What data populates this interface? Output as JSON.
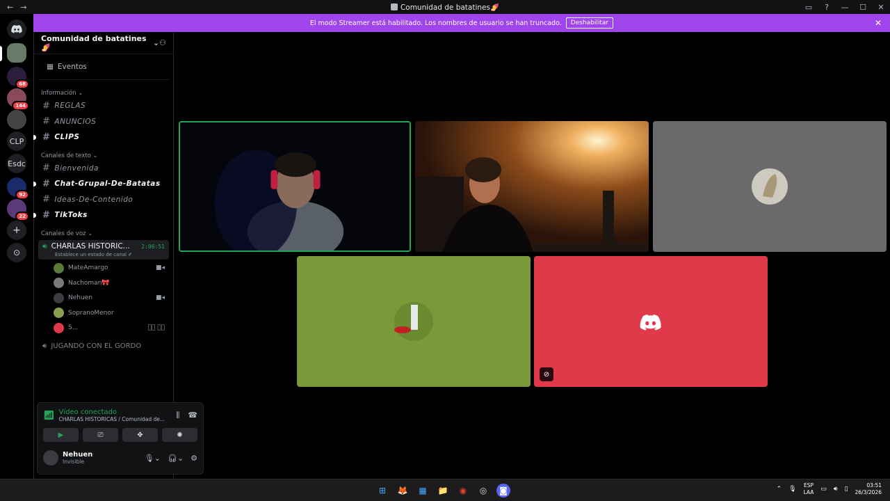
{
  "window": {
    "title": "Comunidad de batatines🍠",
    "back": "←",
    "forward": "→",
    "controls": [
      "▭",
      "?",
      "—",
      "☐",
      "✕"
    ]
  },
  "guilds": [
    {
      "label": "",
      "badge": ""
    },
    {
      "label": "",
      "badge": "68"
    },
    {
      "label": "",
      "badge": "144"
    },
    {
      "label": "",
      "badge": ""
    },
    {
      "label": "CLP",
      "badge": ""
    },
    {
      "label": "Esdc",
      "badge": ""
    },
    {
      "label": "",
      "badge": "92"
    },
    {
      "label": "",
      "badge": "22"
    },
    {
      "label": "+",
      "badge": ""
    },
    {
      "label": "⊙",
      "badge": ""
    }
  ],
  "banner": {
    "text": "El modo Streamer está habilitado. Los nombres de usuario se han truncado.",
    "button": "Deshabilitar",
    "close": "✕"
  },
  "server": {
    "name": "Comunidad de batatines🍠",
    "events": "Eventos",
    "categories": {
      "info": "Información",
      "text": "Canales de texto",
      "voice": "Canales de voz"
    },
    "info_channels": [
      {
        "name": "REGLAS",
        "unread": false
      },
      {
        "name": "ANUNCIOS",
        "unread": false
      },
      {
        "name": "CLIPS",
        "unread": true
      }
    ],
    "text_channels": [
      {
        "name": "Bienvenida",
        "unread": false
      },
      {
        "name": "Chat-Grupal-De-Batatas",
        "unread": true
      },
      {
        "name": "Ideas-De-Contenido",
        "unread": false
      },
      {
        "name": "TikToks",
        "unread": true
      }
    ],
    "voice_channel": {
      "name": "CHARLAS HISTORIC...",
      "timer": "2:06:51",
      "status": "Establece un estado de canal ✐"
    },
    "voice_users": [
      {
        "name": "MateAmargo",
        "color": "#5a7a3a",
        "cam": "■◂"
      },
      {
        "name": "Nachoman🎀",
        "color": "#7a7a7a",
        "cam": ""
      },
      {
        "name": "Nehuen",
        "color": "#3a3c42",
        "cam": "■◂"
      },
      {
        "name": "SopranoMenor",
        "color": "#88a050",
        "cam": ""
      },
      {
        "name": "S...",
        "color": "#e03a4a",
        "cam": "🎙⃠ 🎧⃠"
      }
    ],
    "voice_channel_2": "JUGANDO CON EL GORDO"
  },
  "voice_panel": {
    "status": "Vídeo conectado",
    "channel": "CHARLAS HISTORICAS / Comunidad de...",
    "buttons": [
      "▶",
      "⎚",
      "✥",
      "✺"
    ]
  },
  "user": {
    "name": "Nehuen",
    "status": "Invisible"
  },
  "taskbar": {
    "apps": [
      "⊞",
      "🦊",
      "▦",
      "📁",
      "◉",
      "◎",
      "◙"
    ],
    "lang": "ESP",
    "lang2": "LAA",
    "time": "03:51",
    "date": "26/3/2026"
  },
  "colors": {
    "accent": "#5865f2",
    "banner": "#a044ec",
    "connected": "#23a559",
    "tile_green": "#7a9a3a",
    "tile_red": "#e03a4a",
    "tile_gray": "#6a6a6c"
  }
}
